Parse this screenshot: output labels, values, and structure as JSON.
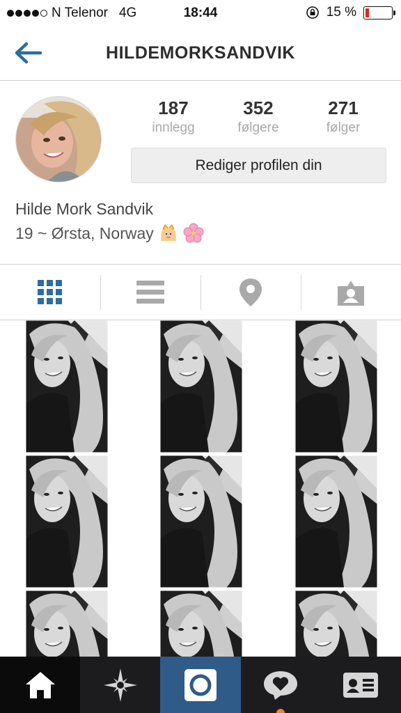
{
  "status_bar": {
    "carrier": "N Telenor",
    "network": "4G",
    "time": "18:44",
    "battery_percent": "15 %",
    "battery_level": 0.15,
    "battery_color": "#e0261d"
  },
  "header": {
    "title": "HILDEMORKSANDVIK",
    "back_icon": "back-arrow-icon",
    "accent_color": "#2d6ca2"
  },
  "profile": {
    "stats": [
      {
        "value": "187",
        "label": "innlegg"
      },
      {
        "value": "352",
        "label": "følgere"
      },
      {
        "value": "271",
        "label": "følger"
      }
    ],
    "edit_button": "Rediger profilen din",
    "full_name": "Hilde Mork Sandvik",
    "bio": "19 ~ Ørsta, Norway",
    "bio_emojis": [
      "princess-emoji",
      "cherry-blossom-emoji"
    ]
  },
  "tabs": [
    {
      "icon": "grid-icon",
      "active": true
    },
    {
      "icon": "list-icon",
      "active": false
    },
    {
      "icon": "location-pin-icon",
      "active": false
    },
    {
      "icon": "tagged-user-icon",
      "active": false
    }
  ],
  "grid": {
    "photo_count": 9
  },
  "bottom_nav": [
    {
      "icon": "home-icon",
      "active": true
    },
    {
      "icon": "explore-icon",
      "active": false
    },
    {
      "icon": "camera-icon",
      "active": false
    },
    {
      "icon": "activity-heart-icon",
      "active": false,
      "has_notification": true
    },
    {
      "icon": "profile-card-icon",
      "active": false
    }
  ]
}
